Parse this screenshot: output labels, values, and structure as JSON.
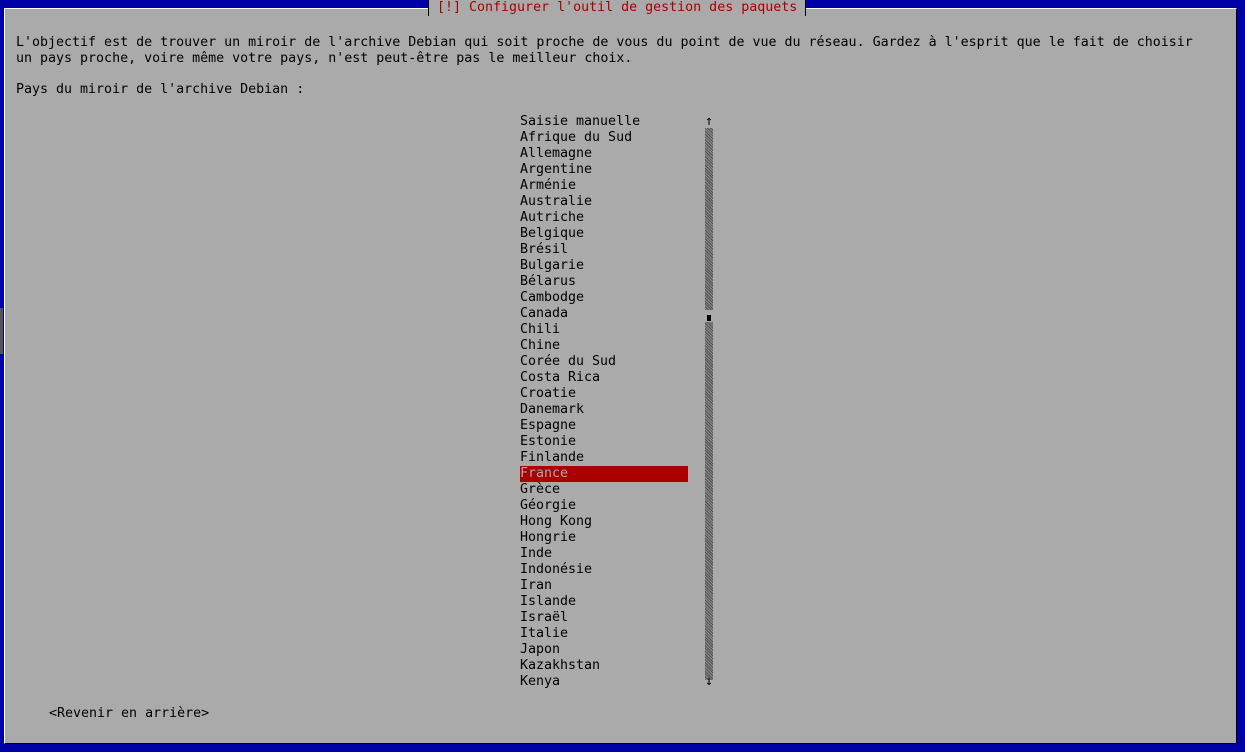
{
  "dialog": {
    "title": "[!] Configurer l'outil de gestion des paquets",
    "description_line1": "L'objectif est de trouver un miroir de l'archive Debian qui soit proche de vous du point de vue du réseau. Gardez à l'esprit que le fait de choisir",
    "description_line2": "un pays proche, voire même votre pays, n'est peut-être pas le meilleur choix.",
    "prompt": "Pays du miroir de l'archive Debian :",
    "back_button": "<Revenir en arrière>"
  },
  "countries": [
    "Saisie manuelle",
    "Afrique du Sud",
    "Allemagne",
    "Argentine",
    "Arménie",
    "Australie",
    "Autriche",
    "Belgique",
    "Brésil",
    "Bulgarie",
    "Bélarus",
    "Cambodge",
    "Canada",
    "Chili",
    "Chine",
    "Corée du Sud",
    "Costa Rica",
    "Croatie",
    "Danemark",
    "Espagne",
    "Estonie",
    "Finlande",
    "France",
    "Grèce",
    "Géorgie",
    "Hong Kong",
    "Hongrie",
    "Inde",
    "Indonésie",
    "Iran",
    "Islande",
    "Israël",
    "Italie",
    "Japon",
    "Kazakhstan",
    "Kenya"
  ],
  "selected_country": "France",
  "scrollbar": {
    "up_arrow": "↑",
    "down_arrow": "↓"
  },
  "colors": {
    "background": "#0000a8",
    "dialog": "#aaaaaa",
    "title_text": "#aa0000",
    "selection": "#aa0000"
  }
}
